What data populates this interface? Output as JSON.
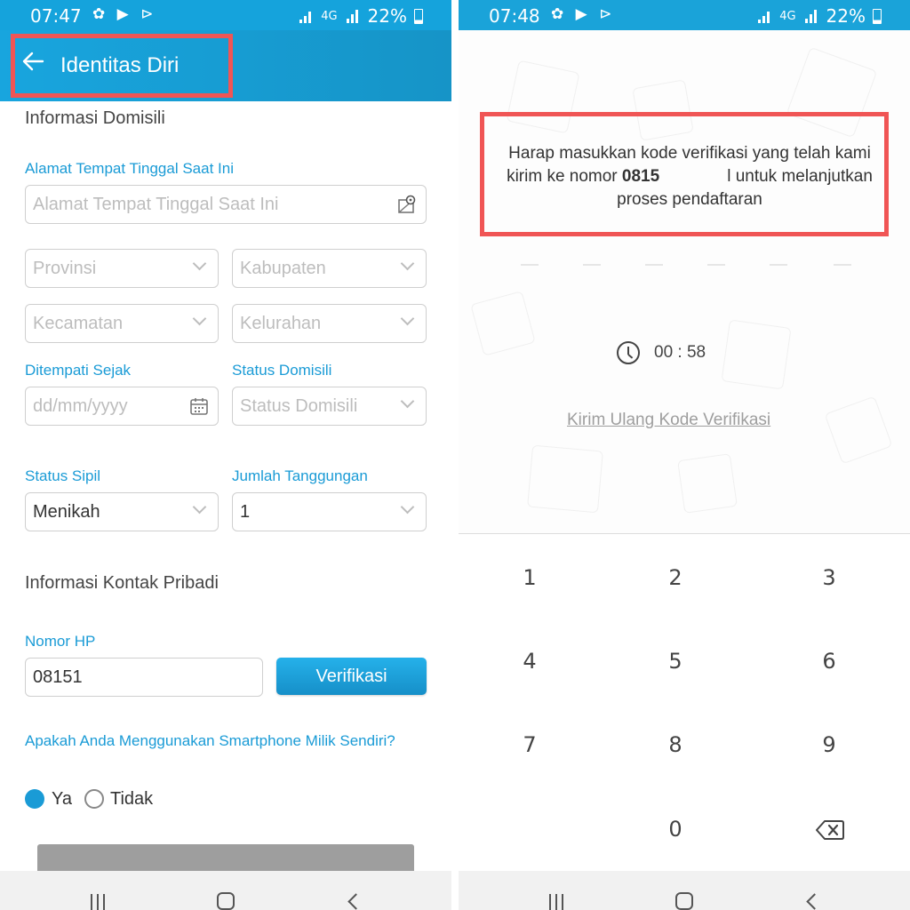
{
  "left_screen": {
    "status_bar": {
      "time": "07:47",
      "battery": "22%",
      "network": "4G"
    },
    "app_bar": {
      "title": "Identitas Diri"
    },
    "domicile": {
      "section_title": "Informasi Domisili",
      "address_label": "Alamat Tempat Tinggal Saat Ini",
      "address_placeholder": "Alamat Tempat Tinggal Saat Ini",
      "province_placeholder": "Provinsi",
      "regency_placeholder": "Kabupaten",
      "district_placeholder": "Kecamatan",
      "village_placeholder": "Kelurahan",
      "since_label": "Ditempati Sejak",
      "since_placeholder": "dd/mm/yyyy",
      "status_label": "Status Domisili",
      "status_placeholder": "Status Domisili",
      "civil_label": "Status Sipil",
      "civil_value": "Menikah",
      "dependents_label": "Jumlah Tanggungan",
      "dependents_value": "1"
    },
    "contact": {
      "section_title": "Informasi Kontak Pribadi",
      "phone_label": "Nomor HP",
      "phone_value": "08151",
      "verify_button": "Verifikasi",
      "smartphone_question": "Apakah Anda Menggunakan Smartphone Milik Sendiri?",
      "option_yes": "Ya",
      "option_no": "Tidak",
      "selected": "Ya"
    }
  },
  "right_screen": {
    "status_bar": {
      "time": "07:48",
      "battery": "22%",
      "network": "4G"
    },
    "message_part1": "Harap masukkan kode verifikasi yang telah kami kirim ke nomor",
    "message_number": "0815",
    "message_part2": "l untuk melanjutkan proses pendaftaran",
    "timer": "00 : 58",
    "resend_link": "Kirim Ulang Kode Verifikasi",
    "keypad": {
      "k1": "1",
      "k2": "2",
      "k3": "3",
      "k4": "4",
      "k5": "5",
      "k6": "6",
      "k7": "7",
      "k8": "8",
      "k9": "9",
      "k0": "0"
    }
  },
  "colors": {
    "primary": "#1a9bd6",
    "app_bar": "#18a5de",
    "highlight": "#f05555",
    "disabled_button": "#9e9e9e"
  },
  "icons": [
    "back-arrow-icon",
    "map-pin-icon",
    "calendar-icon",
    "chevron-down-icon",
    "clock-icon",
    "backspace-icon",
    "nav-recent-icon",
    "nav-home-icon",
    "nav-back-icon"
  ]
}
